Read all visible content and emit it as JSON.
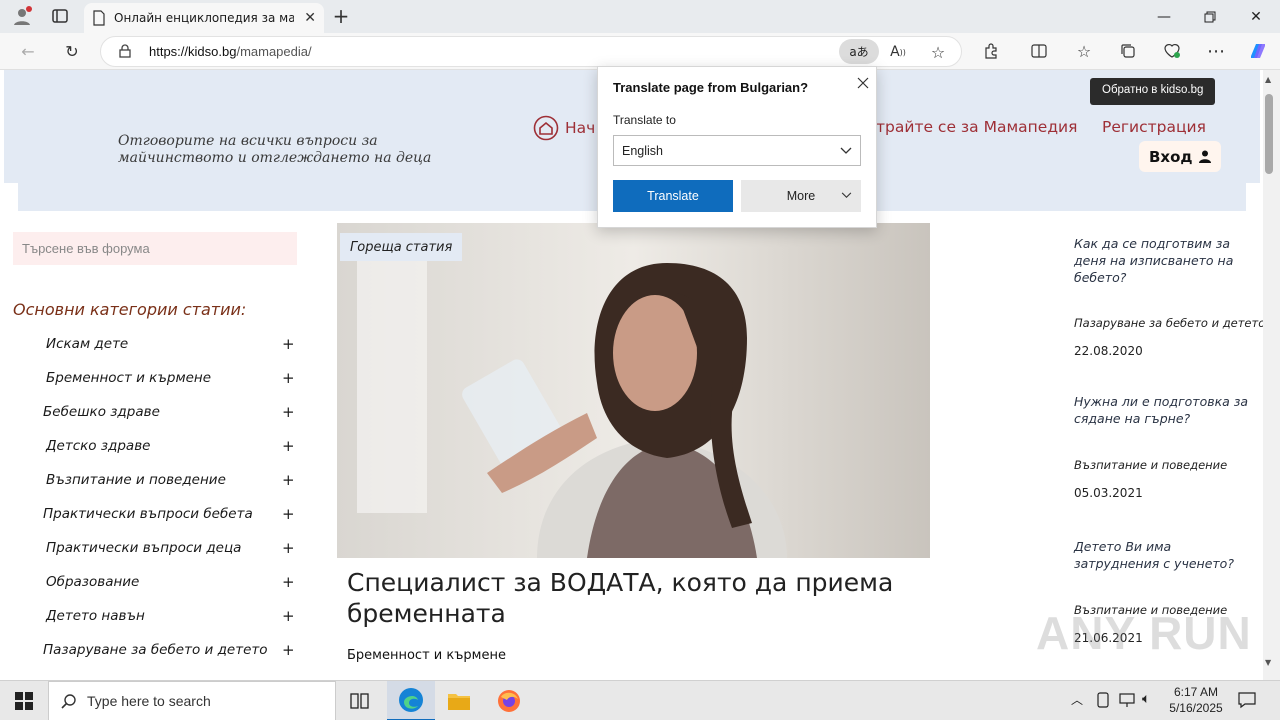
{
  "browser": {
    "tab_title": "Онлайн енциклопедия за майката",
    "url_host": "https://kidso.bg",
    "url_path": "/mamapedia/"
  },
  "header": {
    "tagline": "Отговорите на всички въпроси за майчинството и отглеждането на деца",
    "nav_home": "Нач",
    "nav_register_mamapedia": "трайте се за Мамапедия",
    "nav_register": "Регистрация",
    "login": "Вход",
    "back_tooltip": "Обратно в kidso.bg"
  },
  "sidebar": {
    "search_placeholder": "Търсене във форума",
    "categories_title": "Основни категории статии:",
    "categories": [
      "Искам дете",
      "Бременност и кърмене",
      "Бебешко здраве",
      "Детско здраве",
      "Възпитание и поведение",
      "Практически въпроси бебета",
      "Практически въпроси деца",
      "Образование",
      "Детето навън",
      "Пазаруване за бебето и детето"
    ],
    "plus": "+"
  },
  "main": {
    "hot_label": "Гореща статия",
    "article_title": "Специалист за ВОДАТА, която да приема бременната",
    "article_category": "Бременност и кърмене"
  },
  "right": {
    "items": [
      {
        "title": "Как да се подготвим за деня на изписването на бебето?",
        "category": "Пазаруване за бебето и детето",
        "date": "22.08.2020"
      },
      {
        "title": "Нужна ли е подготовка за сядане на гърне?",
        "category": "Възпитание и поведение",
        "date": "05.03.2021"
      },
      {
        "title": "Детето Ви има затруднения с ученето?",
        "category": "Възпитание и поведение",
        "date": "21.06.2021"
      }
    ]
  },
  "translate_popup": {
    "title": "Translate page from Bulgarian?",
    "label": "Translate to",
    "language": "English",
    "translate_button": "Translate",
    "more_button": "More"
  },
  "taskbar": {
    "search_placeholder": "Type here to search",
    "time": "6:17 AM",
    "date": "5/16/2025"
  },
  "watermark": "ANY RUN",
  "colors": {
    "header_bg": "#e3eaf4",
    "accent_red": "#9e2f36",
    "translate_blue": "#0f6cbd"
  }
}
